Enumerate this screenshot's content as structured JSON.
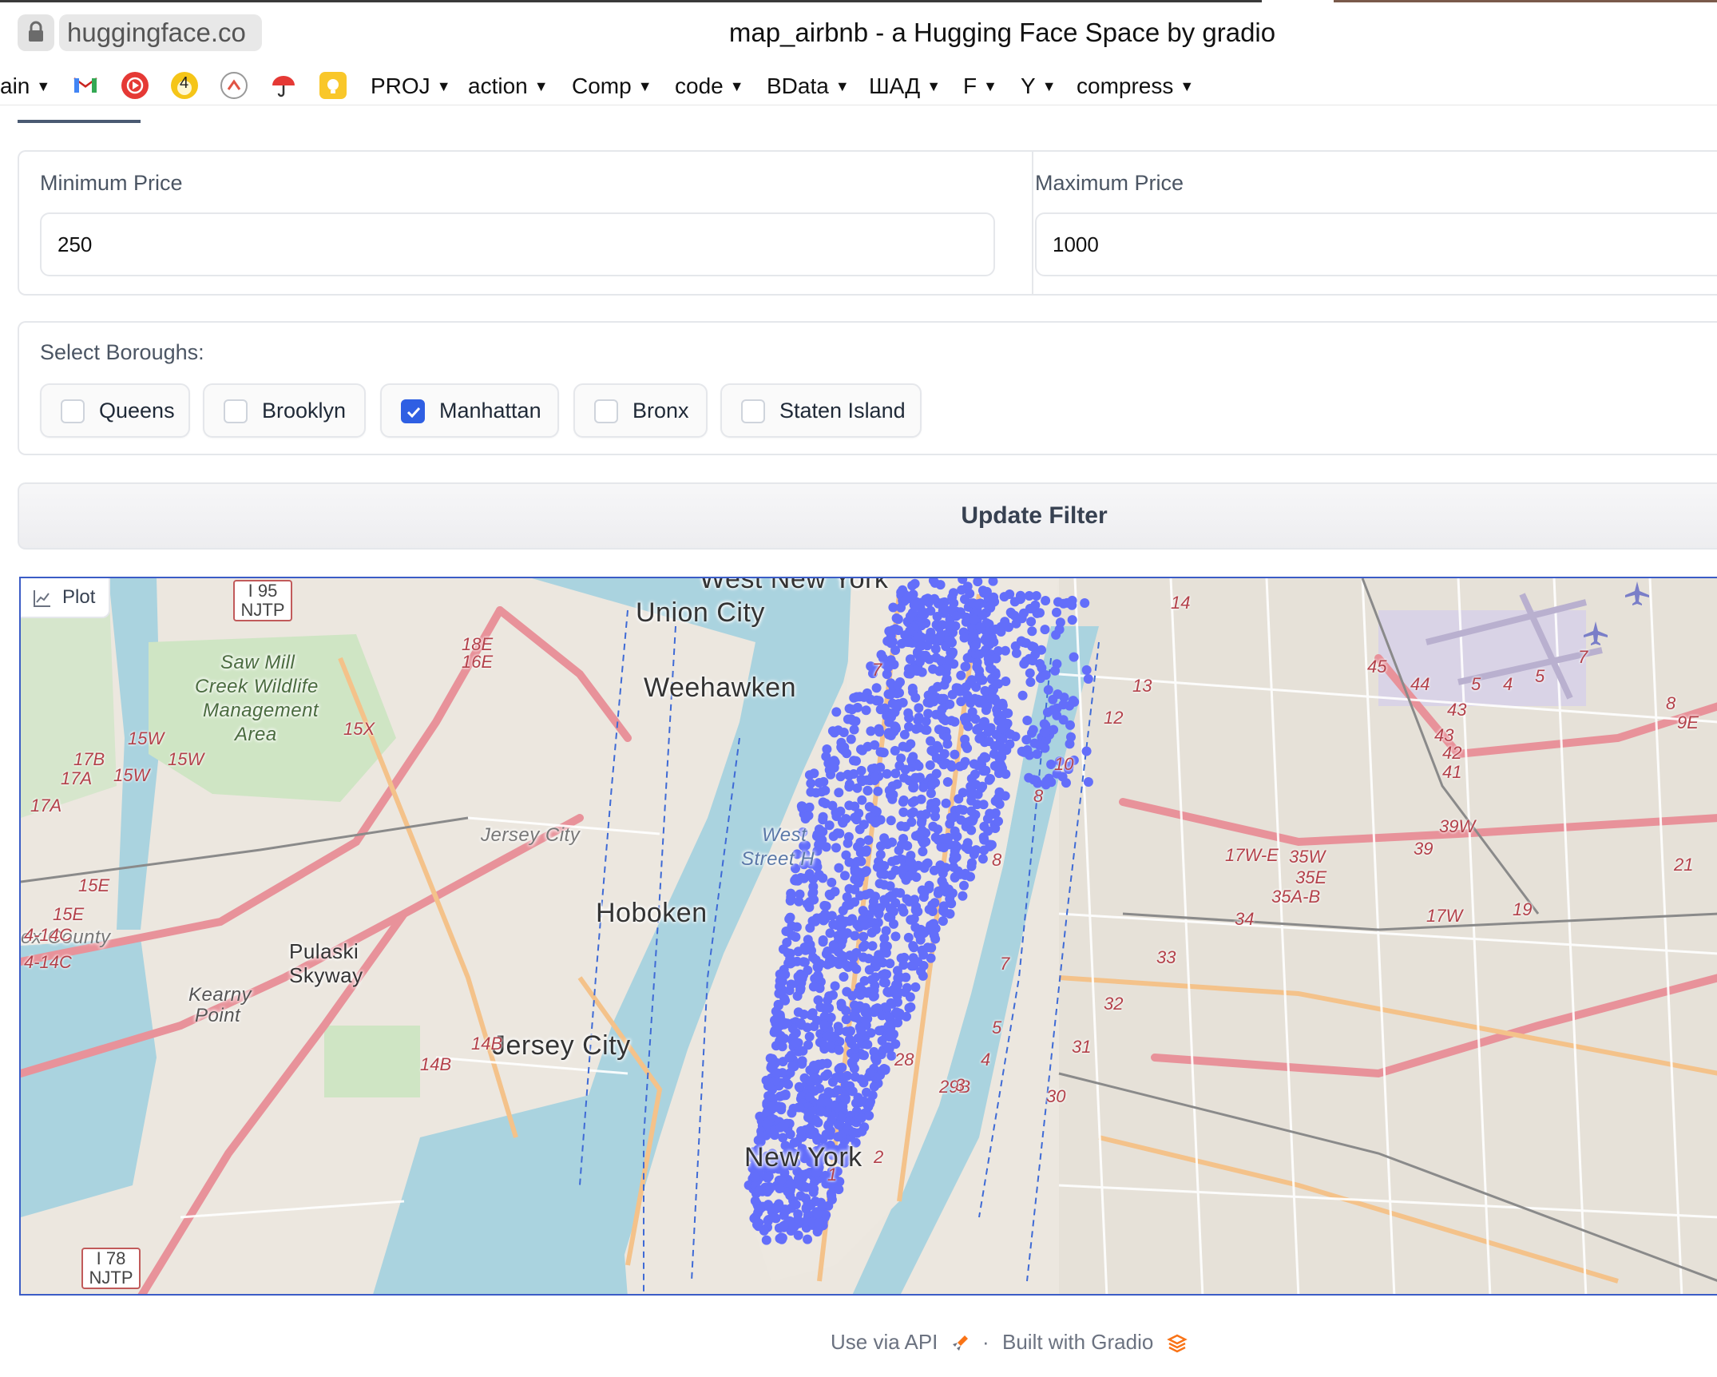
{
  "browser": {
    "url": "huggingface.co",
    "tab_title": "map_airbnb - a Hugging Face Space by gradio",
    "bookmarks": [
      {
        "label": "ain",
        "folder": true
      },
      {
        "label": "PROJ",
        "folder": true
      },
      {
        "label": "action",
        "folder": true
      },
      {
        "label": "Comp",
        "folder": true
      },
      {
        "label": "code",
        "folder": true
      },
      {
        "label": "BData",
        "folder": true
      },
      {
        "label": "ШАД",
        "folder": true
      },
      {
        "label": "F",
        "folder": true
      },
      {
        "label": "Y",
        "folder": true
      },
      {
        "label": "compress",
        "folder": true
      }
    ],
    "bookmark_icons": [
      "gmail-icon",
      "youtube-music-icon",
      "badge-4-icon",
      "arc-icon",
      "umbrella-icon",
      "note-icon"
    ],
    "badge_count": "4"
  },
  "filters": {
    "min_price": {
      "label": "Minimum Price",
      "value": "250"
    },
    "max_price": {
      "label": "Maximum Price",
      "value": "1000"
    },
    "boroughs": {
      "label": "Select Boroughs:",
      "options": [
        {
          "label": "Queens",
          "checked": false
        },
        {
          "label": "Brooklyn",
          "checked": false
        },
        {
          "label": "Manhattan",
          "checked": true
        },
        {
          "label": "Bronx",
          "checked": false
        },
        {
          "label": "Staten Island",
          "checked": false
        }
      ]
    },
    "update_button": "Update Filter"
  },
  "plot": {
    "tag": "Plot",
    "marker_color": "#636efa",
    "place_labels": [
      "Union City",
      "Weehawken",
      "Hoboken",
      "Jersey City",
      "New York",
      "Pulaski",
      "Skyway",
      "West New York"
    ],
    "small_labels": [
      "Kearny",
      "Point",
      "Saw Mill",
      "Creek Wildlife",
      "Management",
      "Area",
      "Jersey City",
      "West",
      "Street H",
      "ex County"
    ],
    "shields": [
      "I 95",
      "NJTP",
      "I 78",
      "NJTP"
    ],
    "route_numbers": [
      "18E",
      "16E",
      "15X",
      "15W",
      "15W",
      "15W",
      "17B",
      "17A",
      "17A",
      "15E",
      "15E",
      "4-14C",
      "4-14C",
      "14B",
      "14B",
      "28",
      "29B",
      "30",
      "31",
      "32",
      "33",
      "34",
      "35W",
      "35E",
      "35A-B",
      "17W-E",
      "17W",
      "19",
      "21",
      "39W",
      "39",
      "41",
      "42",
      "43",
      "43",
      "44",
      "45",
      "5",
      "4",
      "5",
      "7",
      "8",
      "9E",
      "14",
      "13",
      "12",
      "10",
      "8",
      "8",
      "7",
      "5",
      "4",
      "3",
      "2",
      "1",
      "7"
    ]
  },
  "footer": {
    "api": "Use via API",
    "sep": "·",
    "built": "Built with Gradio"
  }
}
